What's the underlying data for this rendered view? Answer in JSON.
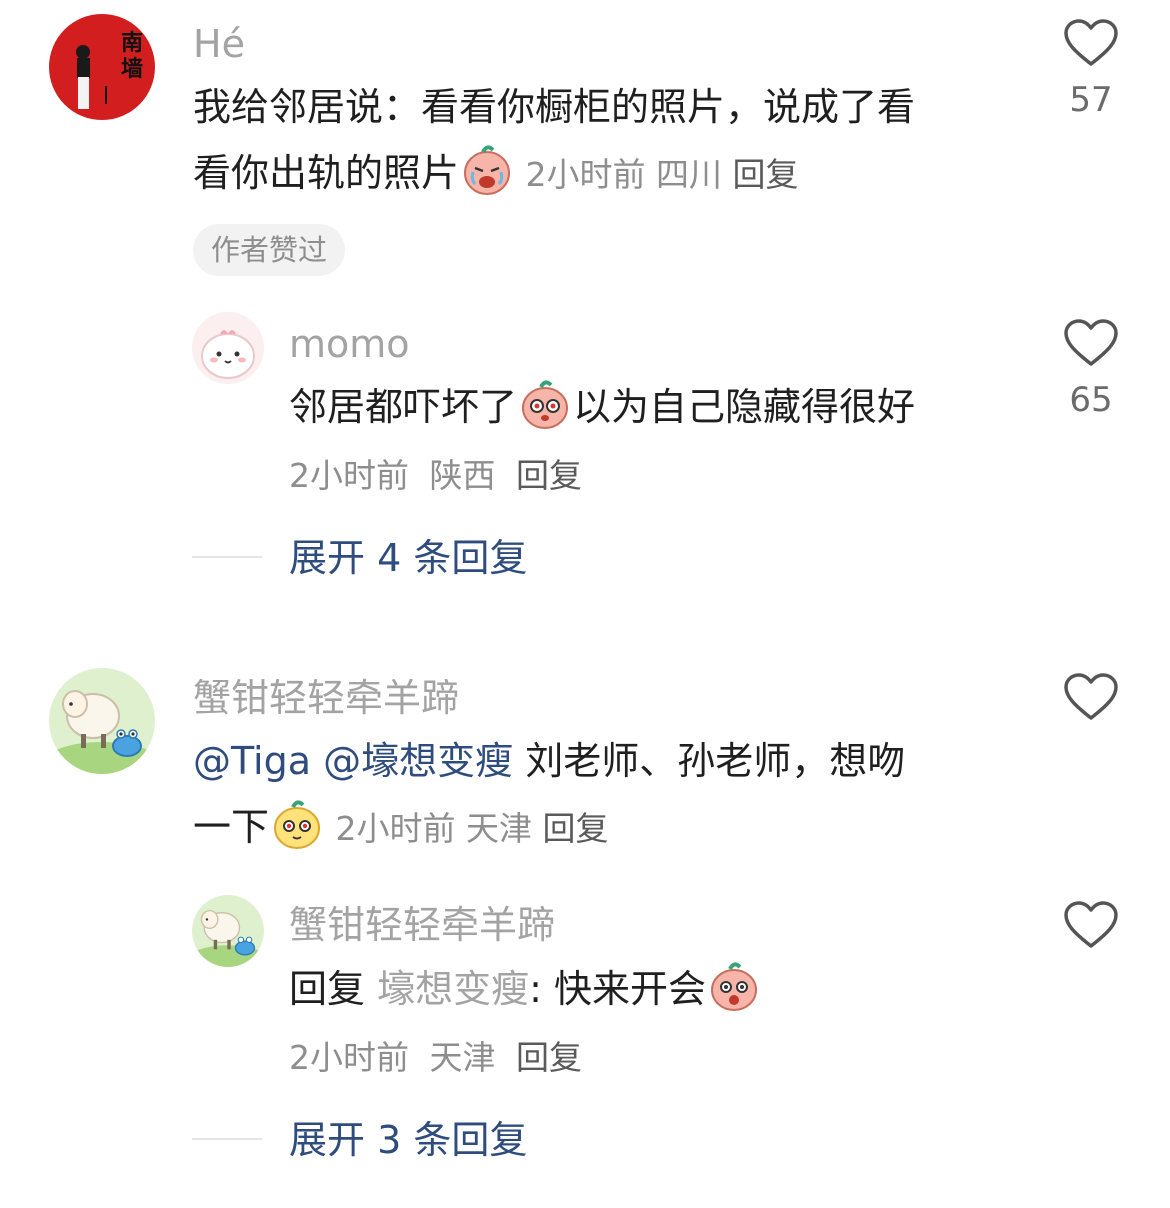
{
  "comments": [
    {
      "username": "Hé",
      "text_line1": "我给邻居说：看看你橱柜的照片，说成了看",
      "text_line2": "看你出轨的照片",
      "time": "2小时前",
      "location": "四川",
      "reply_label": "回复",
      "badge": "作者赞过",
      "likes": "57",
      "emoji": "crying-face-emoji",
      "avatar": "avatar-red-poster",
      "replies": [
        {
          "username": "momo",
          "text_before": "邻居都吓坏了",
          "text_after": "以为自己隐藏得很好",
          "time": "2小时前",
          "location": "陕西",
          "reply_label": "回复",
          "likes": "65",
          "emoji": "shocked-face-emoji",
          "avatar": "avatar-cute-blob"
        }
      ],
      "expand_label": "展开 4 条回复"
    },
    {
      "username": "蟹钳轻轻牵羊蹄",
      "mention1": "@Tiga",
      "mention2": "@壕想变瘦",
      "text_line1_rest": "刘老师、孙老师，想吻",
      "text_line2": "一下",
      "time": "2小时前",
      "location": "天津",
      "reply_label": "回复",
      "emoji": "smirk-face-emoji",
      "avatar": "avatar-sheep-crab",
      "replies": [
        {
          "username": "蟹钳轻轻牵羊蹄",
          "reply_prefix": "回复",
          "reply_target": "壕想变瘦",
          "text": ": 快来开会",
          "time": "2小时前",
          "location": "天津",
          "reply_label": "回复",
          "emoji": "surprised-face-emoji",
          "avatar": "avatar-sheep-crab"
        }
      ],
      "expand_label": "展开 3 条回复"
    }
  ],
  "colors": {
    "link": "#2f4c7e",
    "muted": "#a3a3a3",
    "meta": "#8e8e8e",
    "badge_bg": "#f2f2f2"
  }
}
